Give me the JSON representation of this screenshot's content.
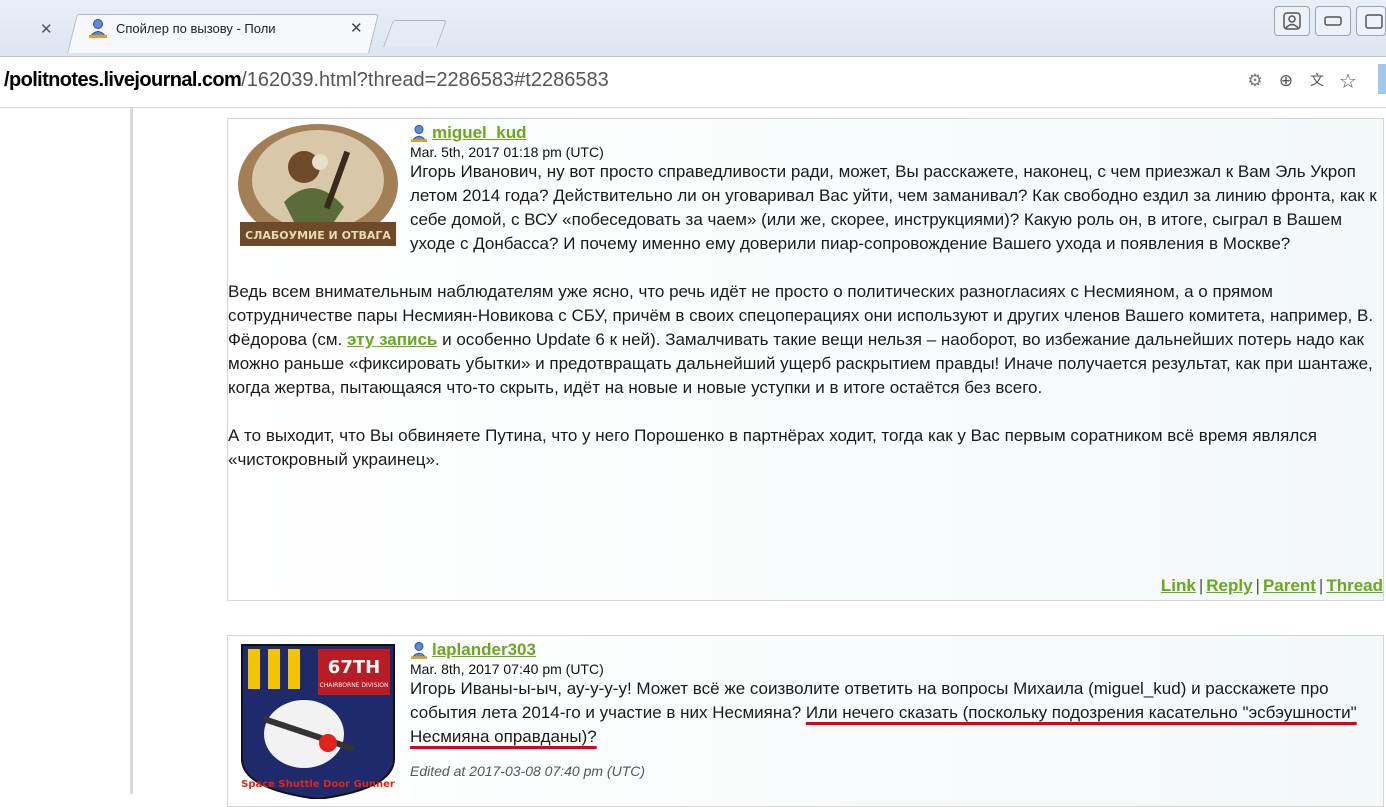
{
  "browser": {
    "tab_title": "Спойлер по вызову - Поли",
    "url_host": "/politnotes.livejournal.com",
    "url_path": "/162039.html?thread=2286583#t2286583"
  },
  "comments": [
    {
      "username": "miguel_kud",
      "timestamp": "Mar. 5th, 2017 01:18 pm (UTC)",
      "avatar_caption": "СЛАБОУМИЕ И ОТВАГА",
      "para1": "Игорь Иванович, ну вот просто справедливости ради, может, Вы расскажете, наконец, с чем приезжал к Вам Эль Укроп летом 2014 года? Действительно ли он уговаривал Вас уйти, чем заманивал? Как свободно ездил за линию фронта, как к себе домой, с ВСУ «побеседовать за чаем» (или же, скорее, инструкциями)? Какую роль он, в итоге, сыграл в Вашем уходе с Донбасса? И почему именно ему доверили пиар-сопровождение Вашего ухода и появления в Москве?",
      "para2_before": "Ведь всем внимательным наблюдателям уже ясно, что речь идёт не просто о политических разногласиях с Несмияном, а о прямом сотрудничестве пары Несмиян-Новикова с СБУ, причём в своих спецоперациях они используют и других членов Вашего комитета, например, В. Фёдорова (см. ",
      "para2_link": "эту запись",
      "para2_after": " и особенно Update 6 к ней). Замалчивать такие вещи нельзя – наоборот, во избежание дальнейших потерь надо как можно раньше «фиксировать убытки» и предотвращать дальнейший ущерб раскрытием правды! Иначе получается результат, как при шантаже, когда жертва, пытающаяся что-то скрыть, идёт на новые и новые уступки и в итоге остаётся без всего.",
      "para3": "А то выходит, что Вы обвиняете Путина, что у него Порошенко в партнёрах ходит, тогда как у Вас первым соратником всё время являлся «чистокровный украинец».",
      "actions": [
        "Link",
        "Reply",
        "Parent",
        "Thread"
      ]
    },
    {
      "username": "laplander303",
      "timestamp": "Mar. 8th, 2017 07:40 pm (UTC)",
      "avatar_top": "67TH",
      "avatar_sub": "CHAIRBORNE DIVISION",
      "avatar_bottom": "Space Shuttle Door Gunner",
      "para1_before": "Игорь Иваны-ы-ыч, ау-у-у-у! Может всё же соизволите ответить на вопросы Михаила (miguel_kud) и расскажете про события лета 2014-го и участие в них Несмияна? ",
      "para1_underlined": "Или нечего сказать (поскольку подозрения касательно \"эсбэушности\" Несмияна оправданы)?",
      "edited": "Edited at 2017-03-08 07:40 pm (UTC)"
    }
  ]
}
